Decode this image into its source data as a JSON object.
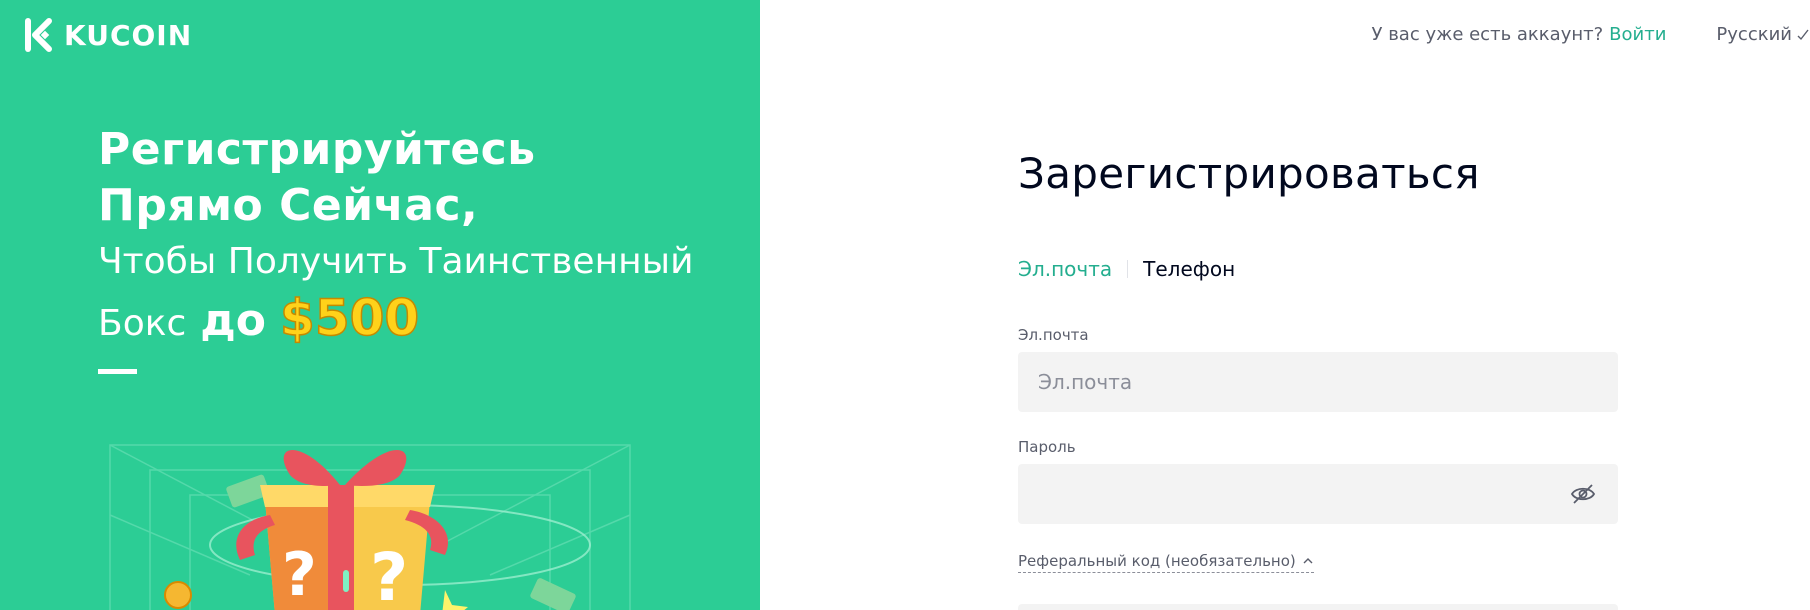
{
  "brand": {
    "name": "KUCOIN",
    "green": "#2ccd95",
    "accent": "#24ae8f",
    "gold": "#ffd21a"
  },
  "hero": {
    "line1": "Регистрируйтесь",
    "line2": "Прямо Сейчас,",
    "line3": "Чтобы Получить Таинственный",
    "line4_plain": "Бокс",
    "line4_bold": "до",
    "line4_amount": "$500"
  },
  "topbar": {
    "have_account": "У вас уже есть аккаунт?",
    "login": "Войти",
    "language": "Русский"
  },
  "form": {
    "title": "Зарегистрироваться",
    "tabs": [
      {
        "label": "Эл.почта",
        "active": true
      },
      {
        "label": "Телефон",
        "active": false
      }
    ],
    "email_label": "Эл.почта",
    "email_placeholder": "Эл.почта",
    "password_label": "Пароль",
    "referral_label": "Реферальный код (необязательно)"
  },
  "icons": {
    "logo": "kucoin-logo-icon",
    "language_chevron": "chevron-down-icon",
    "password_toggle": "eye-off-icon",
    "referral_chevron": "chevron-up-icon"
  }
}
